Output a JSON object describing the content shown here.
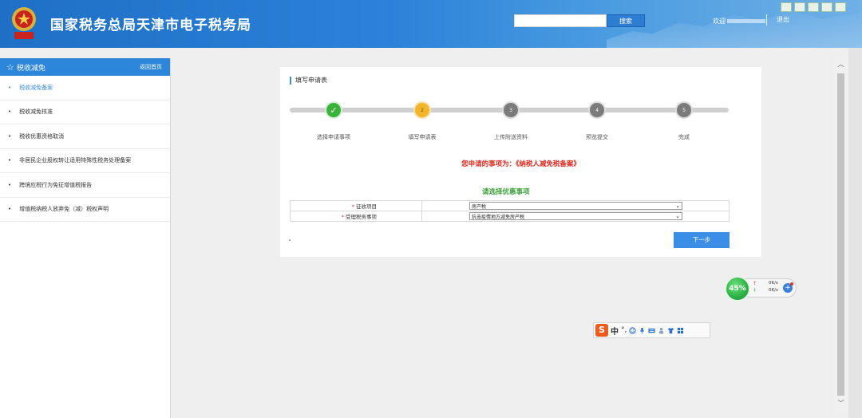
{
  "header": {
    "site_title": "国家税务总局天津市电子税务局",
    "search_placeholder": "",
    "search_button": "搜索",
    "welcome_label": "欢迎",
    "logout_label": "退出"
  },
  "sidebar": {
    "section_title": "税收减免",
    "home_link": "返回首页",
    "items": [
      {
        "label": "税收减免备案",
        "active": true
      },
      {
        "label": "税收减免核准",
        "active": false
      },
      {
        "label": "税收优惠资格取消",
        "active": false
      },
      {
        "label": "非居民企业股权转让适用特殊性税务处理备案",
        "active": false
      },
      {
        "label": "跨境应税行为免征增值税报告",
        "active": false
      },
      {
        "label": "增值税纳税人放弃免（减）税权声明",
        "active": false
      }
    ]
  },
  "form": {
    "card_title": "填写申请表",
    "steps": [
      {
        "number": "✓",
        "label": "选择申请事项",
        "state": "done"
      },
      {
        "number": "2",
        "label": "填写申请表",
        "state": "current"
      },
      {
        "number": "3",
        "label": "上传附送资料",
        "state": "pending"
      },
      {
        "number": "4",
        "label": "预览提交",
        "state": "pending"
      },
      {
        "number": "5",
        "label": "完成",
        "state": "pending"
      }
    ],
    "notice": "您申请的事项为：《纳税人减免税备案》",
    "section_heading": "请选择优惠事项",
    "fields": [
      {
        "label": "征收项目",
        "required_mark": "*",
        "value": "房产税"
      },
      {
        "label": "受理税务事项",
        "required_mark": "*",
        "value": "抗击疫情地方减免房产税"
      }
    ],
    "next_button": "下一步"
  },
  "net_widget": {
    "percent": "45%",
    "up_arrow": "↑",
    "down_arrow": "↓",
    "upload_speed": "0K/s",
    "download_speed": "0K/s",
    "plus": "+"
  },
  "ime_toolbar": {
    "logo": "S",
    "mode": "中",
    "punct": "°,"
  },
  "colors": {
    "header_blue": "#2b82d8",
    "accent_blue": "#3a8ee6",
    "done_green": "#3bb33b",
    "current_orange": "#f3b62a",
    "notice_red": "#e0271c",
    "subhead_green": "#3ca13c"
  }
}
